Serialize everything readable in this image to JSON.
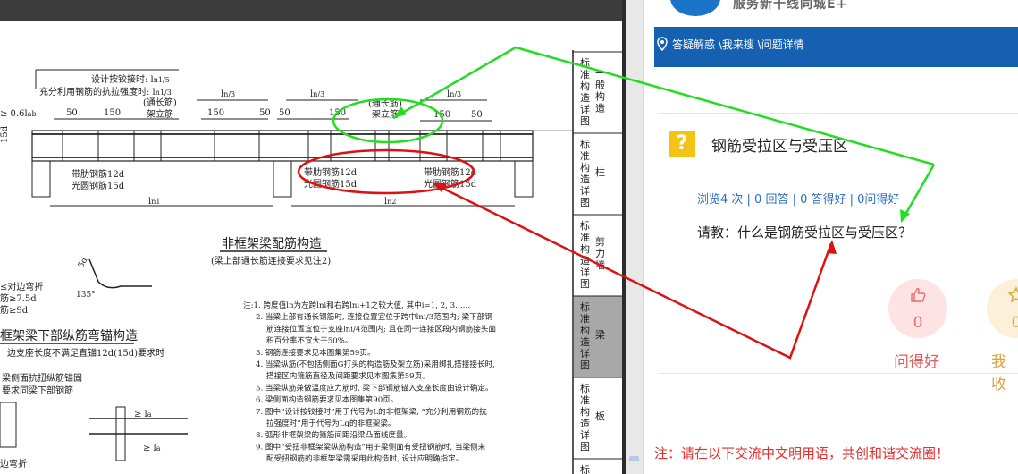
{
  "drawing": {
    "top_formula_1": "设计按铰接时: l",
    "top_formula_1b": "n1/5",
    "top_formula_2": "充分利用钢筋的抗拉强度时: l",
    "top_formula_2b": "n1/3",
    "left_frag": "≥ 0.6l",
    "left_frag_b": "ab",
    "ln3_a": "l",
    "ln3_a_b": "n/3",
    "ln3_b": "l",
    "ln3_b_b": "n/3",
    "ln3_c": "l",
    "ln3_c_b": "n/3",
    "tongchang_1": "(通长筋)",
    "jialijin_1": "架立筋",
    "tongchang_2": "(通长筋)",
    "jialijin_2": "架立筋",
    "dim_50": "50",
    "dim_150": "150",
    "dim_150b": "150",
    "dim_50b": "50",
    "dim_50c": "50",
    "dim_150c": "150",
    "dim_150d": "150",
    "dim_50d": "50",
    "side_15d": "15d",
    "ribbed_1": "带肋钢筋12d",
    "plain_1": "光圆钢筋15d",
    "ribbed_2": "带肋钢筋12d",
    "plain_2": "光圆钢筋15d",
    "ribbed_3": "带肋钢筋12d",
    "plain_3": "光圆钢筋15d",
    "dim_ln1": "l",
    "dim_ln1_b": "n1",
    "dim_ln2": "l",
    "dim_ln2_b": "n2",
    "section_title": "非框架梁配筋构造",
    "section_subtitle": "(梁上部通长筋连接要求见注2)",
    "left_note_1": "≤对边弯折",
    "left_note_2": "筋≥7.5d",
    "left_note_3": "筋≥9d",
    "angle_54d": "5d",
    "angle_135": "135°",
    "bottom_title": "框架梁下部纵筋弯锚构造",
    "bottom_line_1": "边支座长度不满足直锚12d(15d)要求时",
    "bottom_line_2": "梁侧面抗扭纵筋锚固",
    "bottom_line_3": "要求同梁下部钢筋",
    "bottom_line_4": "边弯折",
    "dim_geq_la": "≥ l",
    "dim_geq_la_b": "a",
    "dim_geq_la2": "≥ l",
    "dim_geq_la2_b": "a",
    "notes": [
      "注:1. 跨度值ln为左跨lni和右跨lni+1之较大值, 其中i=1, 2, 3……",
      "2. 当梁上部有通长钢筋时, 连接位置宜位于跨中lni/3范围内; 梁下部钢",
      "筋连接位置宜位于支座lni/4范围内; 且在同一连接区段内钢筋接头面",
      "积百分率不宜大于50%。",
      "3. 钢筋连接要求见本图集第59页。",
      "4. 当梁纵筋(不包括侧面G打头的构造筋及架立筋)采用绑扎搭接接长时,",
      "搭接区内箍筋直径及间距要求见本图集第59页。",
      "5. 当梁纵筋兼做温度应力筋时, 梁下部钢筋锚入支座长度由设计确定。",
      "6. 梁侧面构造钢筋要求见本图集第90页。",
      "7. 图中“设计按铰接时”用于代号为L的非框架梁, “充分利用钢筋的抗",
      "拉强度时”用于代号为Lg的非框架梁。",
      "8. 弧形非框架梁的箍筋间距沿梁凸面线度量。",
      "9. 图中“受扭非框架梁纵筋构造”用于梁侧面有受扭钢筋时, 当梁侧未",
      "配受扭钢筋的非框架梁需采用此构造时, 设计应明确指定。"
    ],
    "tabs": [
      {
        "chars": "标准构造详图",
        "name": "一般构造"
      },
      {
        "chars": "标准构造详图",
        "name": "柱"
      },
      {
        "chars": "标准构造详图",
        "name": "剪力墙"
      },
      {
        "chars": "标准构造详图",
        "name": "梁"
      },
      {
        "chars": "标准构造详图",
        "name": "板"
      },
      {
        "chars": "标准",
        "name": ""
      }
    ]
  },
  "site": {
    "brand": "服务新十线同城E+",
    "breadcrumb": "答疑解惑 \\我来搜 \\问题详情"
  },
  "question": {
    "title": "钢筋受拉区与受压区",
    "stats": "浏览4 次 | 0 回答 | 0 答得好 | 0问得好",
    "body": "请教：什么是钢筋受拉区与受压区？"
  },
  "actions": {
    "good_count": "0",
    "good_label": "问得好",
    "fav_count": "0",
    "fav_label": "我收"
  },
  "notice": "注：请在以下交流中文明用语，共创和谐交流圈！",
  "colors": {
    "accent_blue": "#1560b0",
    "annotation_green": "#22dd22",
    "annotation_red": "#dd1111",
    "question_icon": "#f3c416"
  },
  "icons": [
    "location-pin-icon",
    "question-mark-icon",
    "thumbs-up-icon",
    "star-icon"
  ]
}
